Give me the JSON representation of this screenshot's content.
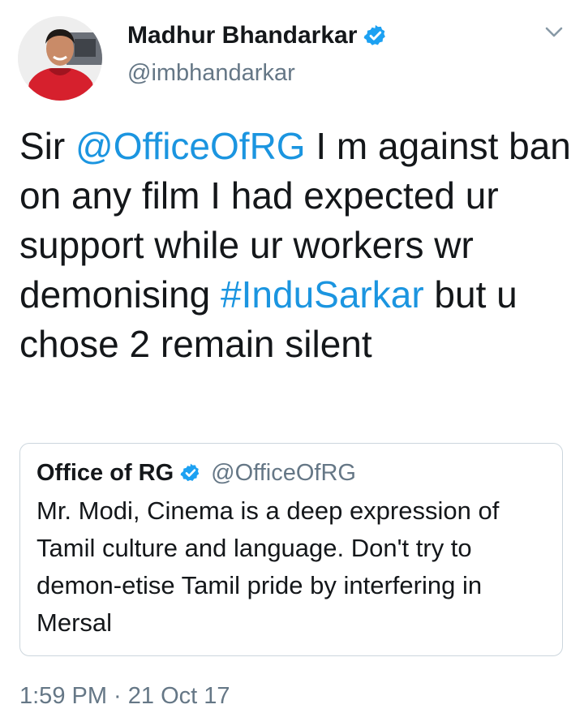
{
  "author": {
    "display_name": "Madhur Bhandarkar",
    "handle": "@imbhandarkar",
    "verified": true,
    "avatar_icon": "profile-photo"
  },
  "tweet": {
    "segments": [
      {
        "text": "Sir ",
        "type": "text"
      },
      {
        "text": "@OfficeOfRG",
        "type": "mention"
      },
      {
        "text": " I m against ban on any film I had expected ur support while ur workers wr demonising ",
        "type": "text"
      },
      {
        "text": "#InduSarkar",
        "type": "hashtag"
      },
      {
        "text": " but u chose 2 remain silent",
        "type": "text"
      }
    ]
  },
  "quoted_tweet": {
    "display_name": "Office of RG",
    "handle": "@OfficeOfRG",
    "verified": true,
    "text": "Mr. Modi, Cinema is a deep expression of Tamil culture and language. Don't try to demon-etise Tamil pride by interfering in Mersal"
  },
  "meta": {
    "timestamp": "1:59 PM · 21 Oct 17"
  },
  "colors": {
    "link": "#1b95e0",
    "verified": "#1da1f2",
    "secondary_text": "#657786",
    "border": "#ccd6dd"
  },
  "icons": {
    "verified": "verified-badge-icon",
    "menu": "chevron-down-icon"
  }
}
